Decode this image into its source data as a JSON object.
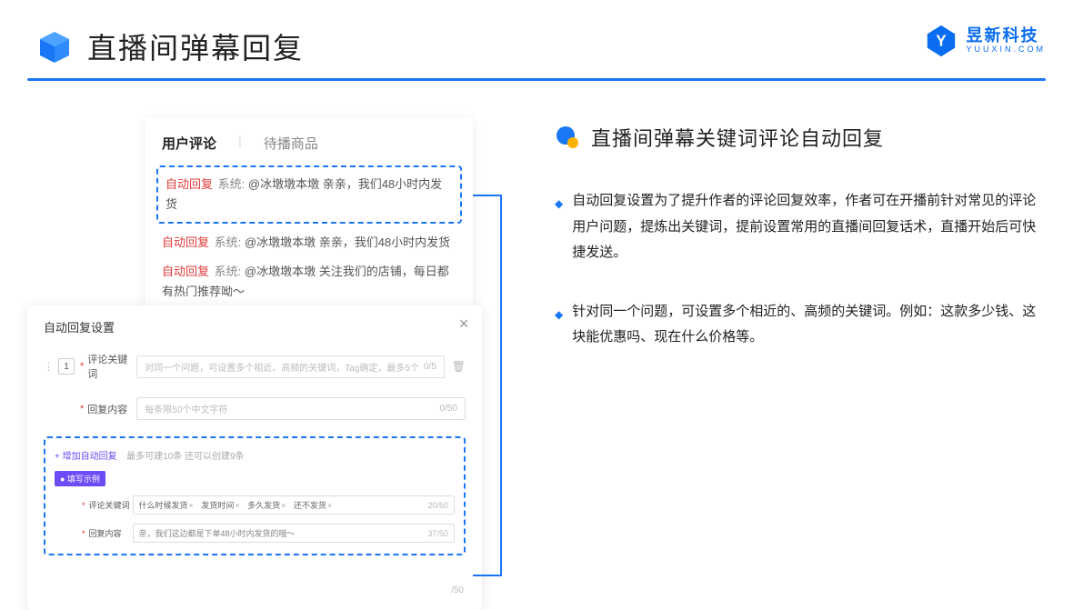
{
  "header": {
    "title": "直播间弹幕回复"
  },
  "brand": {
    "main": "昱新科技",
    "sub": "YUUXIN.COM"
  },
  "comments": {
    "tab_active": "用户评论",
    "tab_inactive": "待播商品",
    "rows": [
      {
        "tag": "自动回复",
        "sys": "系统:",
        "text": "@冰墩墩本墩 亲亲，我们48小时内发货"
      },
      {
        "tag": "自动回复",
        "sys": "系统:",
        "text": "@冰墩墩本墩 亲亲，我们48小时内发货"
      },
      {
        "tag": "自动回复",
        "sys": "系统:",
        "text": "@冰墩墩本墩 关注我们的店铺，每日都有热门推荐呦～"
      }
    ]
  },
  "settings": {
    "title": "自动回复设置",
    "index": "1",
    "kw_label": "评论关键词",
    "kw_placeholder": "对同一个问题，可设置多个相近、高频的关键词，Tag确定，最多5个",
    "kw_counter": "0/5",
    "content_label": "回复内容",
    "content_placeholder": "每条限50个中文字符",
    "content_counter": "0/50",
    "add_link": "+ 增加自动回复",
    "add_note": "最多可建10条 还可以创建9条",
    "example_badge": "● 填写示例",
    "ex_kw_label": "评论关键词",
    "ex_tags": [
      "什么时候发货",
      "发货时间",
      "多久发货",
      "还不发货"
    ],
    "ex_kw_counter": "20/50",
    "ex_content_label": "回复内容",
    "ex_content_value": "亲，我们这边都是下单48小时内发货的哦～",
    "ex_content_counter": "37/50",
    "float_counter": "/50"
  },
  "right": {
    "title": "直播间弹幕关键词评论自动回复",
    "bullets": [
      "自动回复设置为了提升作者的评论回复效率，作者可在开播前针对常见的评论用户问题，提炼出关键词，提前设置常用的直播间回复话术，直播开始后可快捷发送。",
      "针对同一个问题，可设置多个相近的、高频的关键词。例如：这款多少钱、这块能优惠吗、现在什么价格等。"
    ]
  }
}
